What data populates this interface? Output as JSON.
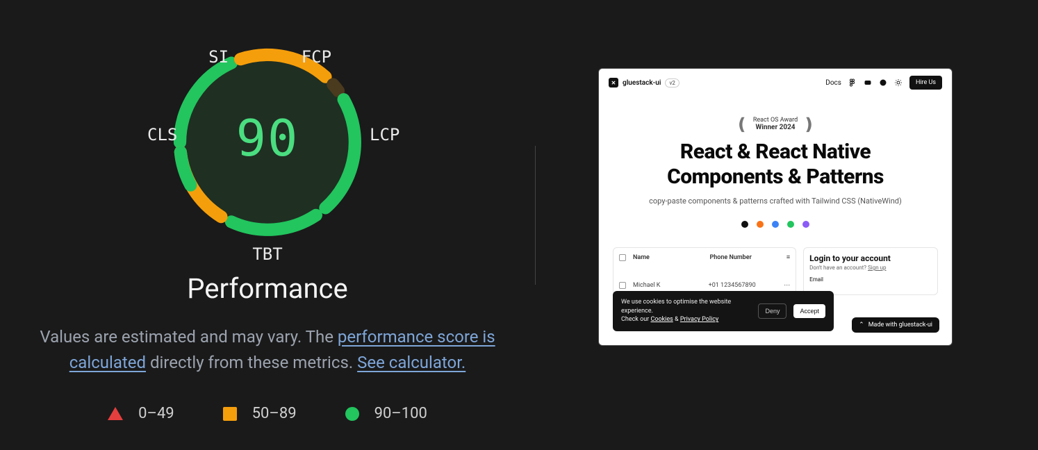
{
  "gauge": {
    "score": "90",
    "title": "Performance",
    "metrics": {
      "si": "SI",
      "fcp": "FCP",
      "lcp": "LCP",
      "tbt": "TBT",
      "cls": "CLS"
    }
  },
  "description": {
    "pre": "Values are estimated and may vary. The ",
    "link1": "performance score is calculated",
    "mid": " directly from these metrics. ",
    "link2": "See calculator."
  },
  "legend": {
    "fail": "0–49",
    "average": "50–89",
    "pass": "90–100"
  },
  "chart_data": {
    "type": "pie",
    "title": "Performance",
    "score": 90,
    "segments": [
      {
        "name": "FCP",
        "status": "pass",
        "color": "#22C55E"
      },
      {
        "name": "SI",
        "status": "average",
        "color": "#F59E0B"
      },
      {
        "name": "LCP",
        "status": "average",
        "color": "#F59E0B"
      },
      {
        "name": "TBT",
        "status": "pass",
        "color": "#22C55E"
      },
      {
        "name": "CLS",
        "status": "pass",
        "color": "#22C55E"
      }
    ],
    "legend": [
      {
        "label": "0–49",
        "shape": "triangle",
        "color": "#E53E3E"
      },
      {
        "label": "50–89",
        "shape": "square",
        "color": "#F59E0B"
      },
      {
        "label": "90–100",
        "shape": "circle",
        "color": "#22C55E"
      }
    ]
  },
  "preview": {
    "brand": "gluestack-ui",
    "version": "v2",
    "nav_docs": "Docs",
    "hire": "Hire Us",
    "award_line1": "React OS Award",
    "award_line2": "Winner 2024",
    "title_line1": "React & React Native",
    "title_line2": "Components & Patterns",
    "subtitle": "copy-paste components & patterns crafted with Tailwind CSS (NativeWind)",
    "dots": [
      "#111111",
      "#F97316",
      "#3B82F6",
      "#22C55E",
      "#8B5CF6"
    ],
    "table": {
      "col_name": "Name",
      "col_phone": "Phone Number",
      "row_name": "Michael K",
      "row_phone": "+01 1234567890"
    },
    "login": {
      "title": "Login to your account",
      "subtitle_pre": "Don't have an account? ",
      "subtitle_link": "Sign up",
      "email_label": "Email"
    },
    "cookie": {
      "line1": "We use cookies to optimise the website experience.",
      "line2_pre": "Check our ",
      "cookies": "Cookies",
      "amp": " & ",
      "privacy": "Privacy Policy",
      "deny": "Deny",
      "accept": "Accept"
    },
    "made_with": "Made with gluestack-ui"
  }
}
